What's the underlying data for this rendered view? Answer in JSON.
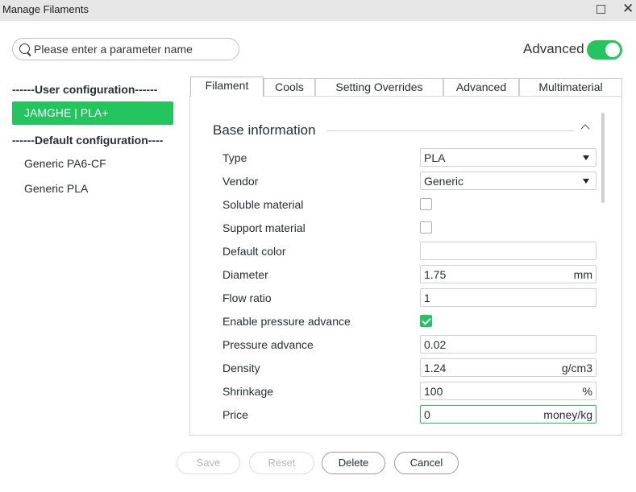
{
  "window": {
    "title": "Manage Filaments"
  },
  "search": {
    "placeholder": "Please enter a parameter name"
  },
  "advanced": {
    "label": "Advanced",
    "enabled": true
  },
  "sidebar": {
    "user_header": "------User configuration------",
    "user_presets": [
      "JAMGHE | PLA+"
    ],
    "default_header": "------Default configuration----",
    "default_presets": [
      "Generic PA6-CF",
      "Generic PLA"
    ]
  },
  "tabs": [
    {
      "label": "Filament",
      "active": true
    },
    {
      "label": "Cools"
    },
    {
      "label": "Setting Overrides"
    },
    {
      "label": "Advanced"
    },
    {
      "label": "Multimaterial"
    }
  ],
  "group": {
    "title": "Base information"
  },
  "params": {
    "type": {
      "label": "Type",
      "value": "PLA"
    },
    "vendor": {
      "label": "Vendor",
      "value": "Generic"
    },
    "soluble": {
      "label": "Soluble material",
      "checked": false
    },
    "support": {
      "label": "Support material",
      "checked": false
    },
    "color": {
      "label": "Default color",
      "value": ""
    },
    "diameter": {
      "label": "Diameter",
      "value": "1.75",
      "unit": "mm"
    },
    "flow": {
      "label": "Flow ratio",
      "value": "1"
    },
    "pa_enable": {
      "label": "Enable pressure advance",
      "checked": true
    },
    "pa": {
      "label": "Pressure advance",
      "value": "0.02"
    },
    "density": {
      "label": "Density",
      "value": "1.24",
      "unit": "g/cm3"
    },
    "shrinkage": {
      "label": "Shrinkage",
      "value": "100",
      "unit": "%"
    },
    "price": {
      "label": "Price",
      "value": "0",
      "unit": "money/kg"
    }
  },
  "buttons": {
    "save": "Save",
    "reset": "Reset",
    "delete": "Delete",
    "cancel": "Cancel"
  },
  "colors": {
    "accent": "#22c55e"
  }
}
